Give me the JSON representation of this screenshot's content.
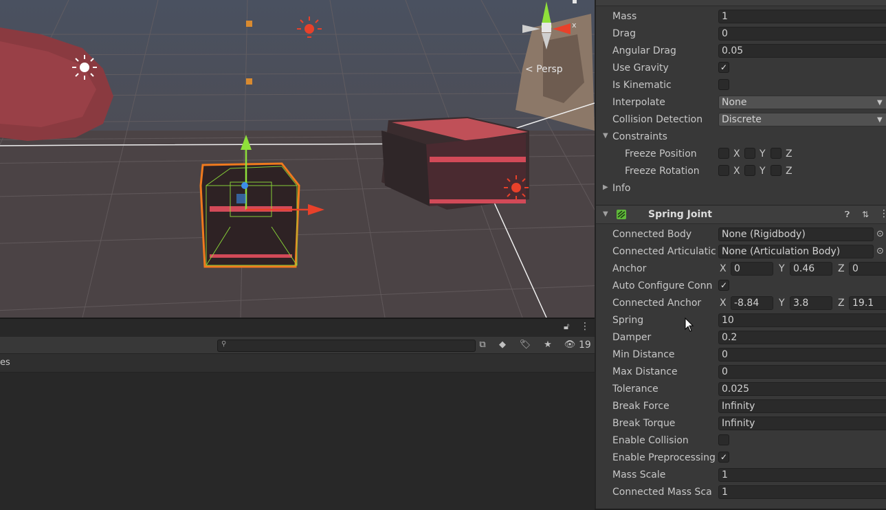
{
  "scene": {
    "persp_label": "Persp",
    "gizmo_axis_x": "x"
  },
  "project": {
    "hidden_count": "19",
    "header_partial": "es"
  },
  "rigidbody": {
    "mass": {
      "label": "Mass",
      "value": "1"
    },
    "drag": {
      "label": "Drag",
      "value": "0"
    },
    "angular_drag": {
      "label": "Angular Drag",
      "value": "0.05"
    },
    "use_gravity": {
      "label": "Use Gravity",
      "checked": true
    },
    "is_kinematic": {
      "label": "Is Kinematic",
      "checked": false
    },
    "interpolate": {
      "label": "Interpolate",
      "value": "None"
    },
    "collision_detection": {
      "label": "Collision Detection",
      "value": "Discrete"
    },
    "constraints": {
      "label": "Constraints"
    },
    "freeze_position": {
      "label": "Freeze Position"
    },
    "freeze_rotation": {
      "label": "Freeze Rotation"
    },
    "info": {
      "label": "Info"
    },
    "axes": {
      "x": "X",
      "y": "Y",
      "z": "Z"
    }
  },
  "spring_joint": {
    "title": "Spring Joint",
    "connected_body": {
      "label": "Connected Body",
      "value": "None (Rigidbody)"
    },
    "connected_articulation": {
      "label": "Connected Articulatic",
      "value": "None (Articulation Body)"
    },
    "anchor": {
      "label": "Anchor",
      "x": "0",
      "y": "0.46",
      "z": "0"
    },
    "auto_configure": {
      "label": "Auto Configure Conn",
      "checked": true
    },
    "connected_anchor": {
      "label": "Connected Anchor",
      "x": "-8.84",
      "y": "3.8",
      "z": "19.1"
    },
    "spring": {
      "label": "Spring",
      "value": "10"
    },
    "damper": {
      "label": "Damper",
      "value": "0.2"
    },
    "min_distance": {
      "label": "Min Distance",
      "value": "0"
    },
    "max_distance": {
      "label": "Max Distance",
      "value": "0"
    },
    "tolerance": {
      "label": "Tolerance",
      "value": "0.025"
    },
    "break_force": {
      "label": "Break Force",
      "value": "Infinity"
    },
    "break_torque": {
      "label": "Break Torque",
      "value": "Infinity"
    },
    "enable_collision": {
      "label": "Enable Collision",
      "checked": false
    },
    "enable_preprocessing": {
      "label": "Enable Preprocessing",
      "checked": true
    },
    "mass_scale": {
      "label": "Mass Scale",
      "value": "1"
    },
    "connected_mass_scale": {
      "label": "Connected Mass Sca",
      "value": "1"
    }
  },
  "colors": {
    "accent_orange": "#f07a1e",
    "gizmo_green": "#8fe03a",
    "gizmo_red": "#e8412a",
    "gizmo_blue": "#3c8eea"
  }
}
